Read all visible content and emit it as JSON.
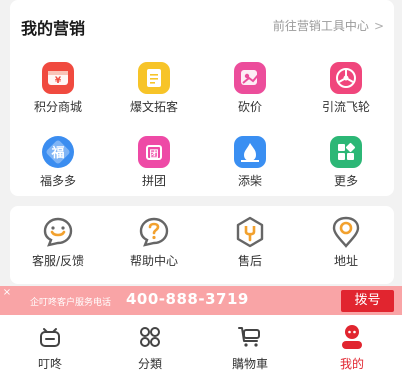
{
  "marketing": {
    "title": "我的营销",
    "tool_center_link": "前往营销工具中心",
    "items": [
      {
        "label": "积分商城",
        "icon": "points-mall-icon",
        "color": "#f04a3f"
      },
      {
        "label": "爆文拓客",
        "icon": "article-icon",
        "color": "#f7c428"
      },
      {
        "label": "砍价",
        "icon": "bargain-icon",
        "color": "#ec4d9b"
      },
      {
        "label": "引流飞轮",
        "icon": "flywheel-icon",
        "color": "#f0467c"
      },
      {
        "label": "福多多",
        "icon": "fu-icon",
        "color": "#3b8df0"
      },
      {
        "label": "拼团",
        "icon": "group-buy-icon",
        "color": "#ee4aa6"
      },
      {
        "label": "添柴",
        "icon": "add-fire-icon",
        "color": "#3a8ff2"
      },
      {
        "label": "更多",
        "icon": "more-icon",
        "color": "#2cb776"
      }
    ]
  },
  "service": {
    "items": [
      {
        "label": "客服/反馈",
        "icon": "customer-service-icon"
      },
      {
        "label": "帮助中心",
        "icon": "help-center-icon"
      },
      {
        "label": "售后",
        "icon": "after-sales-icon"
      },
      {
        "label": "地址",
        "icon": "address-icon"
      }
    ]
  },
  "banner": {
    "hotline_label": "企叮咚客户服务电话",
    "hotline_number": "400-888-3719",
    "dial_button": "拨号",
    "close_icon": "×"
  },
  "tabbar": {
    "tabs": [
      {
        "label": "叮咚",
        "icon": "dingdong-icon",
        "active": false
      },
      {
        "label": "分類",
        "icon": "category-icon",
        "active": false
      },
      {
        "label": "購物車",
        "icon": "cart-icon",
        "active": false
      },
      {
        "label": "我的",
        "icon": "profile-icon",
        "active": true
      }
    ]
  },
  "colors": {
    "accent_red": "#e1252f",
    "banner_pink": "#f9a4a6",
    "background": "#f2f2f2"
  }
}
